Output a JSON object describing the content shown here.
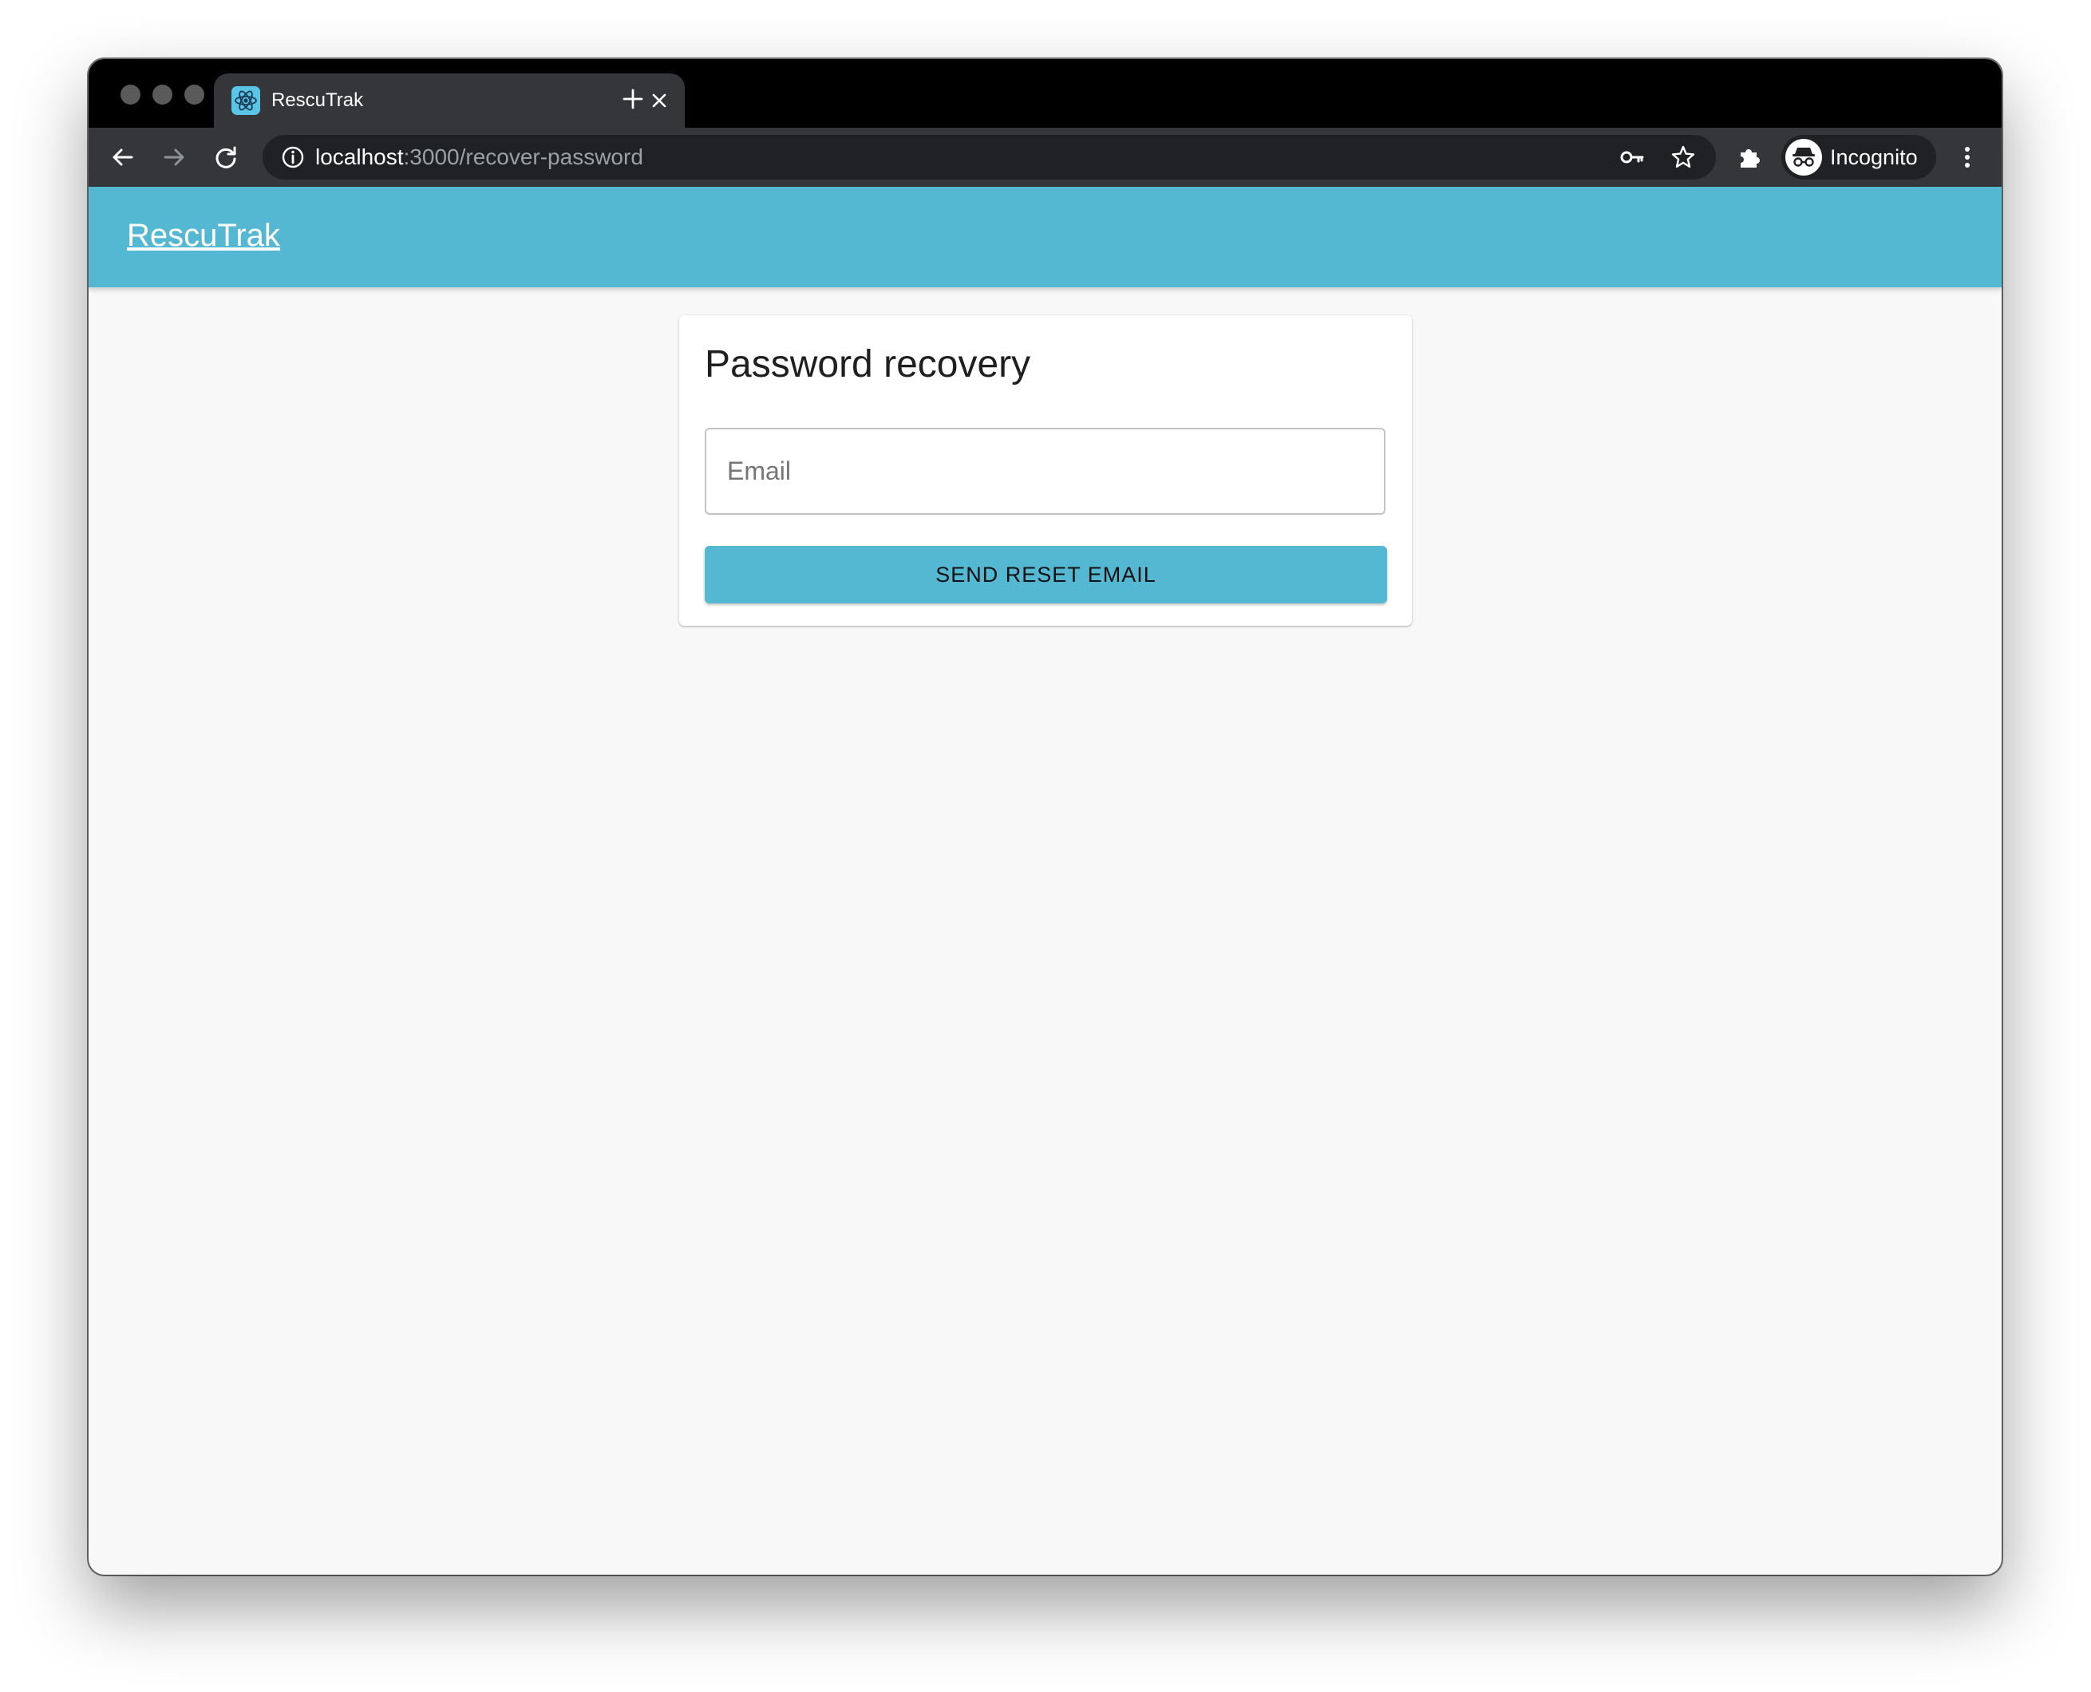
{
  "browser": {
    "tab_title": "RescuTrak",
    "url_host": "localhost",
    "url_path": ":3000/recover-password",
    "profile_label": "Incognito"
  },
  "app": {
    "brand": "RescuTrak"
  },
  "recovery_card": {
    "title": "Password recovery",
    "email_placeholder": "Email",
    "email_value": "",
    "submit_label": "SEND RESET EMAIL"
  },
  "icons": {
    "tab_favicon": "react-atom-icon",
    "back": "arrow-left-icon",
    "forward": "arrow-right-icon",
    "reload": "reload-icon",
    "site_info": "info-circle-icon",
    "password_key": "key-icon",
    "bookmark": "star-icon",
    "extensions": "puzzle-icon",
    "incognito": "incognito-icon",
    "menu": "kebab-menu-icon"
  },
  "colors": {
    "accent": "#54b8d2",
    "page_bg": "#f8f8f8",
    "card_bg": "#ffffff",
    "chrome_dark": "#35363a"
  }
}
